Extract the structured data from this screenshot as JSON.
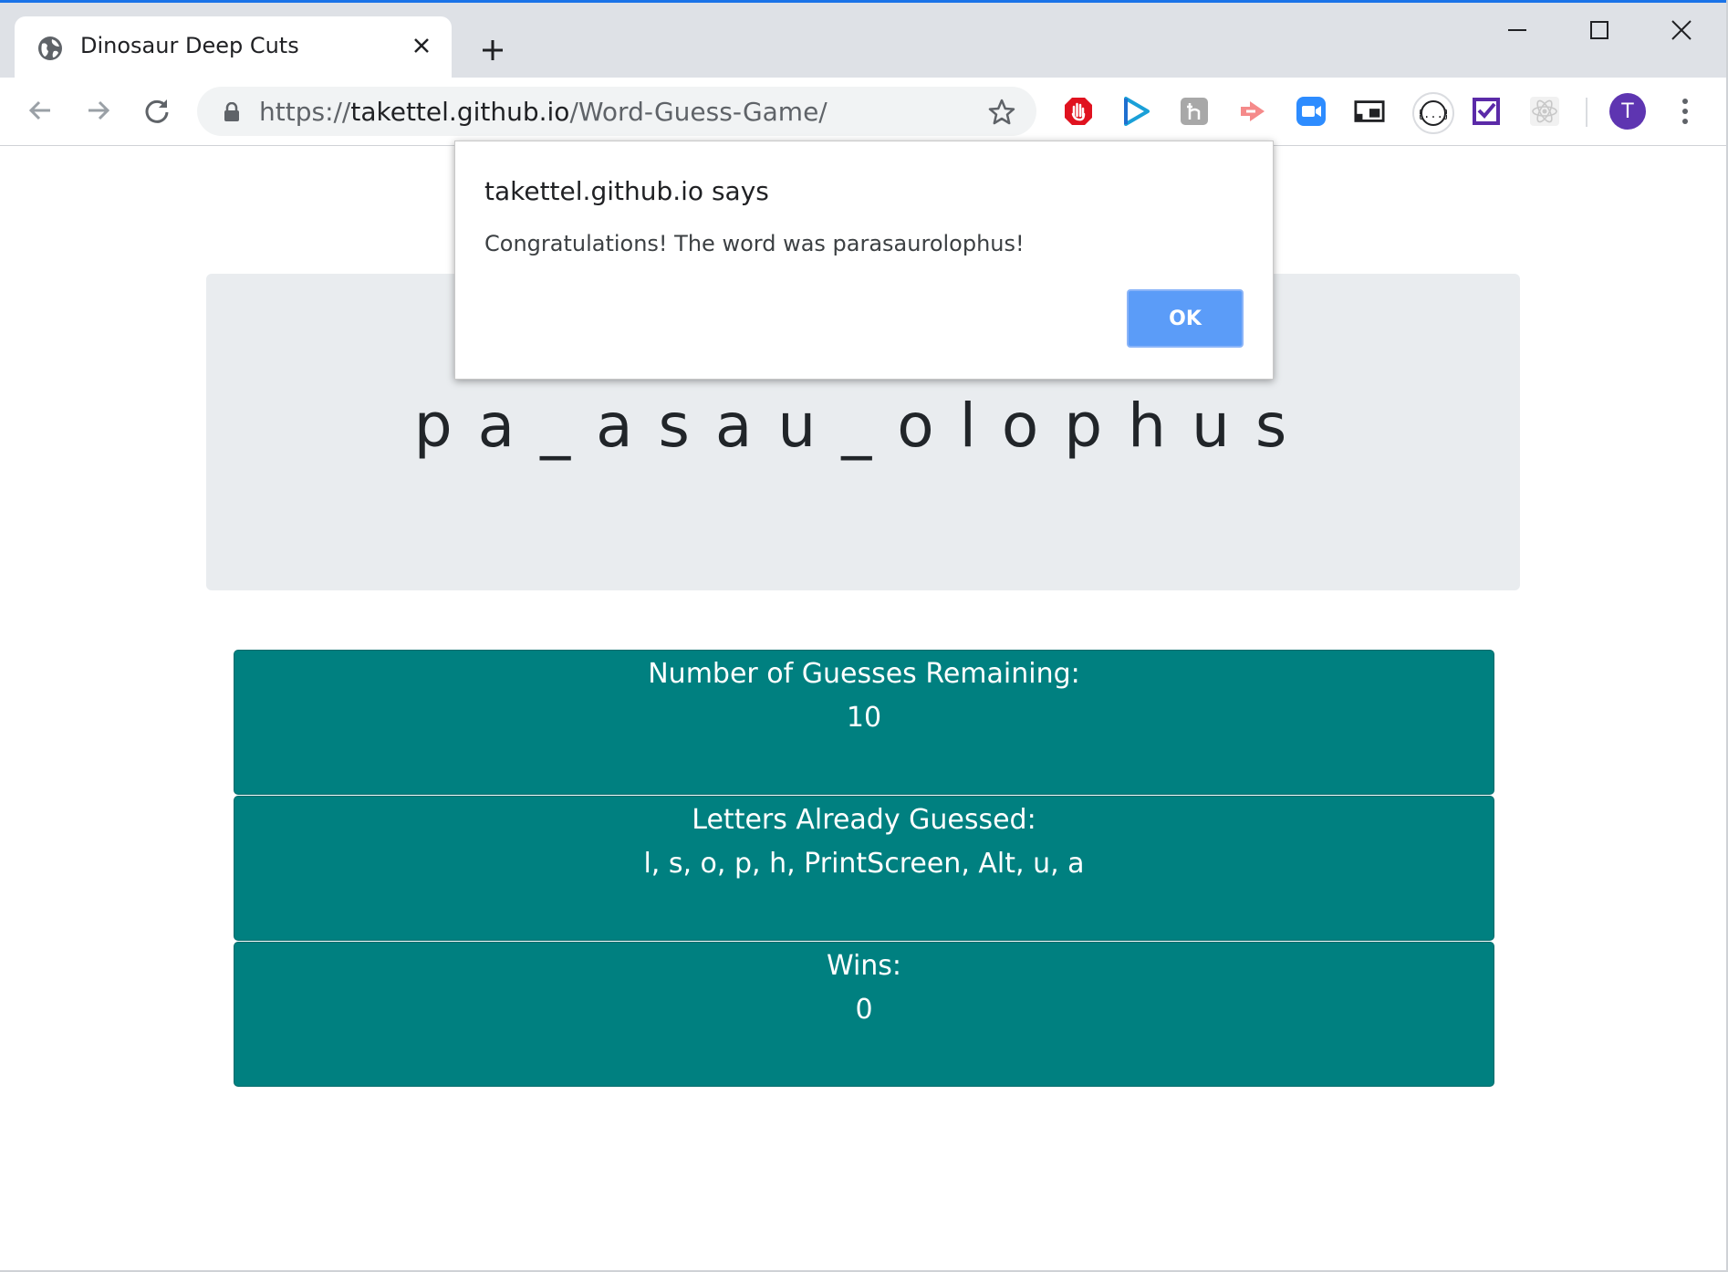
{
  "browser": {
    "tab": {
      "title": "Dinosaur Deep Cuts"
    },
    "url": {
      "scheme": "https://",
      "host": "takettel.github.io",
      "path": "/Word-Guess-Game/"
    },
    "profile_initial": "T",
    "accent_color": "#1a73e8",
    "extensions": [
      "adblock-icon",
      "play-icon",
      "h-icon",
      "arrow-icon",
      "zoom-icon",
      "cast-icon",
      "code-icon",
      "check-icon",
      "react-icon"
    ]
  },
  "page": {
    "current_word": "pa_asau_olophus",
    "guesses_label": "Number of Guesses Remaining:",
    "guesses_value": "10",
    "letters_label": "Letters Already Guessed:",
    "letters_value": "l, s, o, p, h, PrintScreen, Alt, u, a",
    "wins_label": "Wins:",
    "wins_value": "0",
    "panel_color": "#008080"
  },
  "dialog": {
    "title": "takettel.github.io says",
    "message": "Congratulations! The word was parasaurolophus!",
    "ok_label": "OK"
  }
}
